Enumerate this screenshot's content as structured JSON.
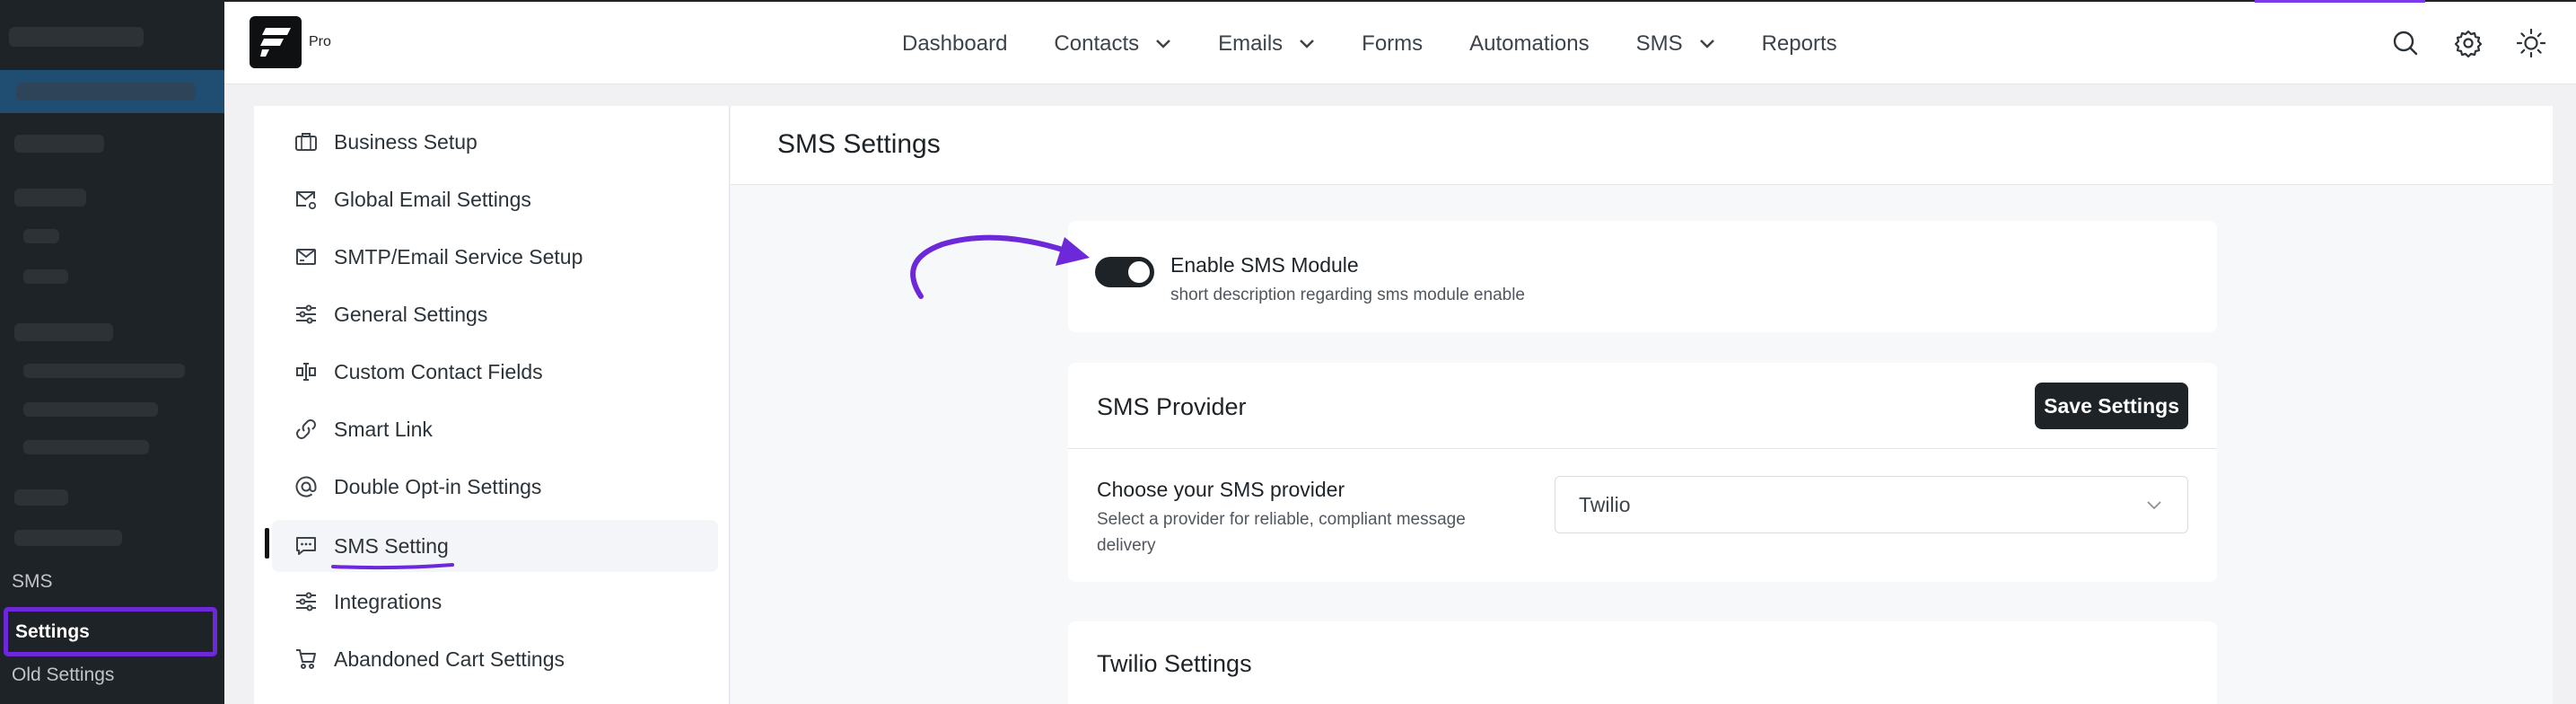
{
  "wp_sidebar": {
    "items": [
      {
        "label": "SMS"
      },
      {
        "label": "Settings"
      },
      {
        "label": "Old Settings"
      }
    ]
  },
  "header": {
    "logo_badge": "Pro",
    "nav": [
      {
        "label": "Dashboard",
        "has_dropdown": false
      },
      {
        "label": "Contacts",
        "has_dropdown": true
      },
      {
        "label": "Emails",
        "has_dropdown": true
      },
      {
        "label": "Forms",
        "has_dropdown": false
      },
      {
        "label": "Automations",
        "has_dropdown": false
      },
      {
        "label": "SMS",
        "has_dropdown": true
      },
      {
        "label": "Reports",
        "has_dropdown": false
      }
    ],
    "tools": [
      "search-icon",
      "gear-icon",
      "sun-icon"
    ]
  },
  "settings_nav": {
    "items": [
      {
        "label": "Business Setup",
        "icon": "briefcase-icon"
      },
      {
        "label": "Global Email Settings",
        "icon": "mail-settings-icon"
      },
      {
        "label": "SMTP/Email Service Setup",
        "icon": "mail-send-icon"
      },
      {
        "label": "General Settings",
        "icon": "sliders-icon"
      },
      {
        "label": "Custom Contact Fields",
        "icon": "fields-icon"
      },
      {
        "label": "Smart Link",
        "icon": "link-icon"
      },
      {
        "label": "Double Opt-in Settings",
        "icon": "at-icon"
      },
      {
        "label": "SMS Setting",
        "icon": "chat-icon"
      },
      {
        "label": "Integrations",
        "icon": "sliders-icon"
      },
      {
        "label": "Abandoned Cart Settings",
        "icon": "cart-icon"
      }
    ],
    "active": "SMS Setting"
  },
  "main": {
    "title": "SMS Settings",
    "sms_module": {
      "title": "Enable SMS Module",
      "description": "short description regarding sms module enable",
      "enabled": true
    },
    "provider": {
      "title": "SMS Provider",
      "save_label": "Save Settings",
      "choose_title": "Choose your SMS provider",
      "choose_desc": "Select a provider for reliable, compliant message delivery",
      "selected": "Twilio"
    },
    "twilio": {
      "title": "Twilio Settings"
    }
  },
  "colors": {
    "accent": "#6d28d9",
    "dark": "#1d2327",
    "wp_sidebar": "#1d2327"
  }
}
